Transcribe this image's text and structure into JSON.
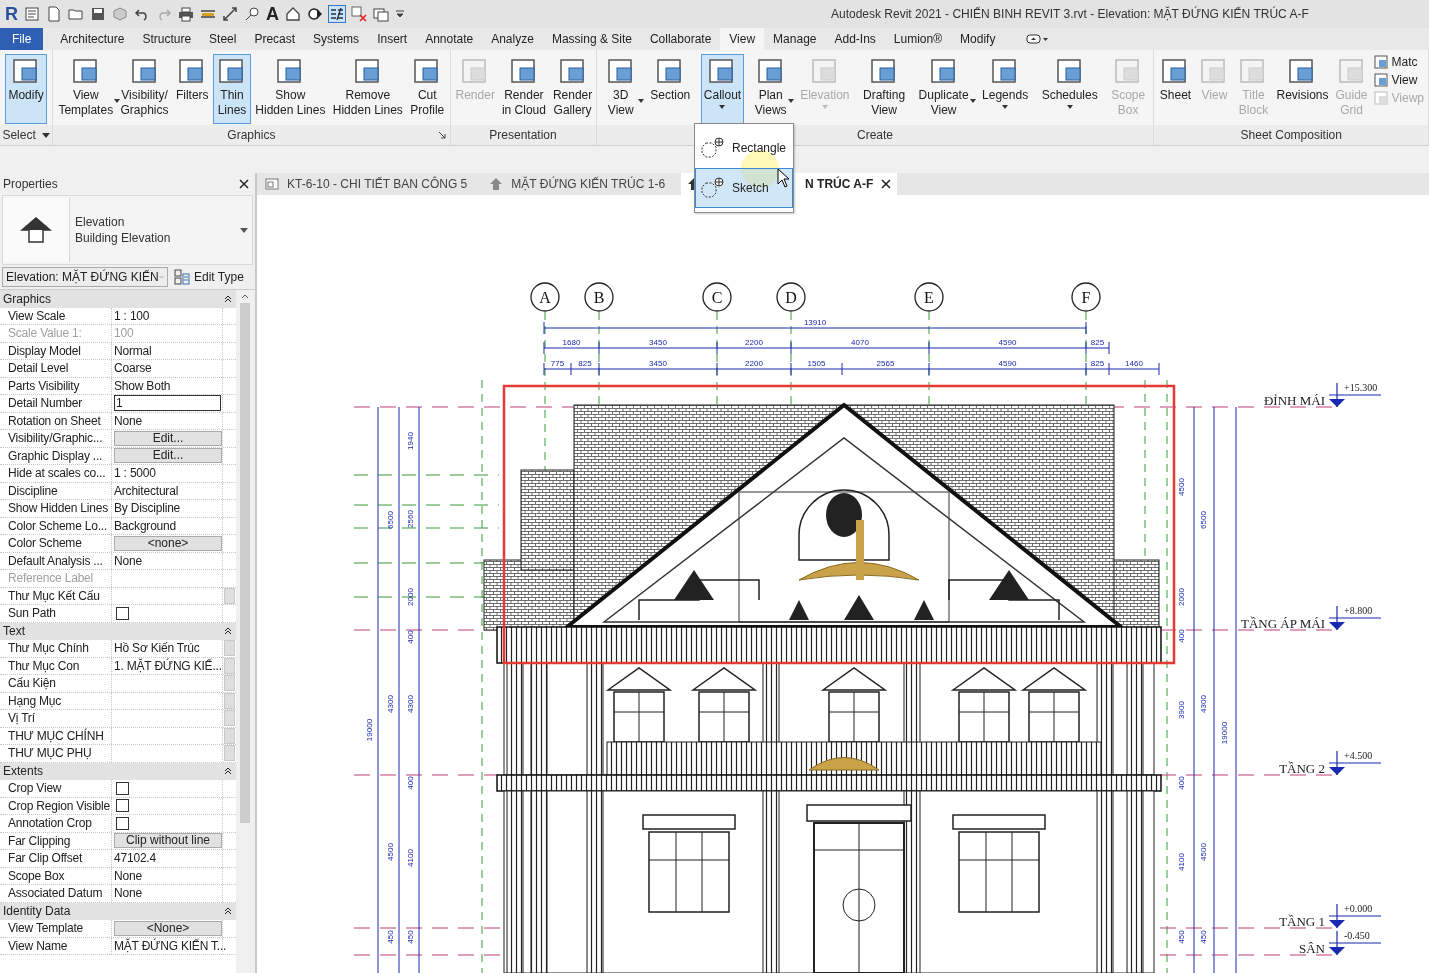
{
  "app": {
    "logo": "R",
    "text_tool": "A",
    "title": "Autodesk Revit 2021 - CHIẾN BINH REVIT 3.rvt - Elevation: MẶT ĐỨNG KIẾN TRÚC A-F"
  },
  "ribbon_tabs": [
    {
      "label": "File",
      "kind": "file",
      "selected": false
    },
    {
      "label": "Architecture",
      "kind": "tab",
      "selected": false
    },
    {
      "label": "Structure",
      "kind": "tab",
      "selected": false
    },
    {
      "label": "Steel",
      "kind": "tab",
      "selected": false
    },
    {
      "label": "Precast",
      "kind": "tab",
      "selected": false
    },
    {
      "label": "Systems",
      "kind": "tab",
      "selected": false
    },
    {
      "label": "Insert",
      "kind": "tab",
      "selected": false
    },
    {
      "label": "Annotate",
      "kind": "tab",
      "selected": false
    },
    {
      "label": "Analyze",
      "kind": "tab",
      "selected": false
    },
    {
      "label": "Massing & Site",
      "kind": "tab",
      "selected": false
    },
    {
      "label": "Collaborate",
      "kind": "tab",
      "selected": false
    },
    {
      "label": "View",
      "kind": "tab",
      "selected": true
    },
    {
      "label": "Manage",
      "kind": "tab",
      "selected": false
    },
    {
      "label": "Add-Ins",
      "kind": "tab",
      "selected": false
    },
    {
      "label": "Lumion®",
      "kind": "tab",
      "selected": false
    },
    {
      "label": "Modify",
      "kind": "tab",
      "selected": false
    }
  ],
  "ribbon_panels": [
    {
      "title": "Select",
      "title_menu": true,
      "launcher": false,
      "items": [
        {
          "kind": "large",
          "lines": [
            "Modify"
          ],
          "selected": true,
          "disabled": false,
          "side_menu": false,
          "below_menu": false
        }
      ]
    },
    {
      "title": "Graphics",
      "title_menu": false,
      "launcher": true,
      "items": [
        {
          "kind": "large",
          "lines": [
            "View",
            "Templates"
          ],
          "selected": false,
          "disabled": false,
          "side_menu": true,
          "below_menu": false
        },
        {
          "kind": "large",
          "lines": [
            "Visibility/",
            "Graphics"
          ],
          "selected": false,
          "disabled": false,
          "side_menu": false,
          "below_menu": false
        },
        {
          "kind": "large",
          "lines": [
            "Filters"
          ],
          "selected": false,
          "disabled": false,
          "side_menu": false,
          "below_menu": false
        },
        {
          "kind": "large",
          "lines": [
            "Thin",
            "Lines"
          ],
          "selected": true,
          "disabled": false,
          "side_menu": false,
          "below_menu": false
        },
        {
          "kind": "large",
          "lines": [
            "Show",
            "Hidden Lines"
          ],
          "selected": false,
          "disabled": false,
          "side_menu": false,
          "below_menu": false
        },
        {
          "kind": "large",
          "lines": [
            "Remove",
            "Hidden Lines"
          ],
          "selected": false,
          "disabled": false,
          "side_menu": false,
          "below_menu": false
        },
        {
          "kind": "large",
          "lines": [
            "Cut",
            "Profile"
          ],
          "selected": false,
          "disabled": false,
          "side_menu": false,
          "below_menu": false
        }
      ]
    },
    {
      "title": "Presentation",
      "title_menu": false,
      "launcher": false,
      "items": [
        {
          "kind": "large",
          "lines": [
            "Render"
          ],
          "selected": false,
          "disabled": true,
          "side_menu": false,
          "below_menu": false
        },
        {
          "kind": "large",
          "lines": [
            "Render",
            "in Cloud"
          ],
          "selected": false,
          "disabled": false,
          "side_menu": false,
          "below_menu": false
        },
        {
          "kind": "large",
          "lines": [
            "Render",
            "Gallery"
          ],
          "selected": false,
          "disabled": false,
          "side_menu": false,
          "below_menu": false
        }
      ]
    },
    {
      "title": "Create",
      "title_menu": false,
      "launcher": false,
      "items": [
        {
          "kind": "large",
          "lines": [
            "3D",
            "View"
          ],
          "selected": false,
          "disabled": false,
          "side_menu": true,
          "below_menu": false
        },
        {
          "kind": "large",
          "lines": [
            "Section"
          ],
          "selected": false,
          "disabled": false,
          "side_menu": false,
          "below_menu": false
        },
        {
          "kind": "large",
          "lines": [
            "Callout"
          ],
          "selected": true,
          "disabled": false,
          "side_menu": false,
          "below_menu": true
        },
        {
          "kind": "large",
          "lines": [
            "Plan",
            "Views"
          ],
          "selected": false,
          "disabled": false,
          "side_menu": true,
          "below_menu": false
        },
        {
          "kind": "large",
          "lines": [
            "Elevation"
          ],
          "selected": false,
          "disabled": true,
          "side_menu": false,
          "below_menu": true
        },
        {
          "kind": "large",
          "lines": [
            "Drafting",
            "View"
          ],
          "selected": false,
          "disabled": false,
          "side_menu": false,
          "below_menu": false
        },
        {
          "kind": "large",
          "lines": [
            "Duplicate",
            "View"
          ],
          "selected": false,
          "disabled": false,
          "side_menu": true,
          "below_menu": false
        },
        {
          "kind": "large",
          "lines": [
            "Legends"
          ],
          "selected": false,
          "disabled": false,
          "side_menu": false,
          "below_menu": true
        },
        {
          "kind": "large",
          "lines": [
            "Schedules"
          ],
          "selected": false,
          "disabled": false,
          "side_menu": false,
          "below_menu": true
        },
        {
          "kind": "large",
          "lines": [
            "Scope",
            "Box"
          ],
          "selected": false,
          "disabled": true,
          "side_menu": false,
          "below_menu": false
        }
      ]
    },
    {
      "title": "Sheet Composition",
      "title_menu": false,
      "launcher": false,
      "items": [
        {
          "kind": "large",
          "lines": [
            "Sheet"
          ],
          "selected": false,
          "disabled": false,
          "side_menu": false,
          "below_menu": false
        },
        {
          "kind": "large",
          "lines": [
            "View"
          ],
          "selected": false,
          "disabled": true,
          "side_menu": false,
          "below_menu": false
        },
        {
          "kind": "large",
          "lines": [
            "Title",
            "Block"
          ],
          "selected": false,
          "disabled": true,
          "side_menu": false,
          "below_menu": false
        },
        {
          "kind": "large",
          "lines": [
            "Revisions"
          ],
          "selected": false,
          "disabled": false,
          "side_menu": false,
          "below_menu": false
        },
        {
          "kind": "large",
          "lines": [
            "Guide",
            "Grid"
          ],
          "selected": false,
          "disabled": true,
          "side_menu": false,
          "below_menu": false
        },
        {
          "kind": "small",
          "entries": [
            {
              "label": "Matc",
              "disabled": false
            },
            {
              "label": "View",
              "disabled": false
            },
            {
              "label": "Viewp",
              "disabled": true
            }
          ]
        }
      ]
    }
  ],
  "callout_menu": [
    {
      "label": "Rectangle",
      "selected": false
    },
    {
      "label": "Sketch",
      "selected": true
    }
  ],
  "view_tabs": [
    {
      "label": "KT-6-10 - CHI TIẾT BAN CÔNG 5",
      "kind": "sheet",
      "selected": false,
      "closable": false
    },
    {
      "label": "MẶT ĐỨNG KIẾN TRÚC 1-6",
      "kind": "elevation",
      "selected": false,
      "closable": false
    },
    {
      "label": "N TRÚC A-F",
      "kind": "elevation",
      "selected": true,
      "closable": true
    }
  ],
  "properties": {
    "title": "Properties",
    "type_name": "Elevation",
    "type_detail": "Building Elevation",
    "instance": "Elevation: MẶT ĐỨNG KIẾN",
    "edit_type": "Edit Type",
    "sections": [
      {
        "name": "Graphics",
        "expanded": true,
        "rows": [
          {
            "label": "View Scale",
            "value": "1 : 100",
            "kind": "text",
            "disabled": false,
            "browse": false
          },
          {
            "label": "Scale Value    1:",
            "value": "100",
            "kind": "text",
            "disabled": true,
            "browse": false
          },
          {
            "label": "Display Model",
            "value": "Normal",
            "kind": "text",
            "disabled": false,
            "browse": false
          },
          {
            "label": "Detail Level",
            "value": "Coarse",
            "kind": "text",
            "disabled": false,
            "browse": false
          },
          {
            "label": "Parts Visibility",
            "value": "Show Both",
            "kind": "text",
            "disabled": false,
            "browse": false
          },
          {
            "label": "Detail Number",
            "value": "1",
            "kind": "input",
            "disabled": false,
            "browse": false
          },
          {
            "label": "Rotation on Sheet",
            "value": "None",
            "kind": "text",
            "disabled": false,
            "browse": false
          },
          {
            "label": "Visibility/Graphic...",
            "value": "Edit...",
            "kind": "button",
            "disabled": false,
            "browse": false
          },
          {
            "label": "Graphic Display ...",
            "value": "Edit...",
            "kind": "button",
            "disabled": false,
            "browse": false
          },
          {
            "label": "Hide at scales co...",
            "value": "1 : 5000",
            "kind": "text",
            "disabled": false,
            "browse": false
          },
          {
            "label": "Discipline",
            "value": "Architectural",
            "kind": "text",
            "disabled": false,
            "browse": false
          },
          {
            "label": "Show Hidden Lines",
            "value": "By Discipline",
            "kind": "text",
            "disabled": false,
            "browse": false
          },
          {
            "label": "Color Scheme Lo...",
            "value": "Background",
            "kind": "text",
            "disabled": false,
            "browse": false
          },
          {
            "label": "Color Scheme",
            "value": "<none>",
            "kind": "button",
            "disabled": false,
            "browse": false
          },
          {
            "label": "Default Analysis ...",
            "value": "None",
            "kind": "text",
            "disabled": false,
            "browse": false
          },
          {
            "label": "Reference Label",
            "kind": "text",
            "disabled": true,
            "browse": false
          },
          {
            "label": "Thư Mục Kết Cấu",
            "kind": "text",
            "disabled": false,
            "browse": true
          },
          {
            "label": "Sun Path",
            "kind": "checkbox",
            "checked": false,
            "disabled": false,
            "browse": false
          }
        ]
      },
      {
        "name": "Text",
        "expanded": true,
        "rows": [
          {
            "label": "Thư Mục Chính",
            "value": "Hồ Sơ Kiến Trúc",
            "kind": "text",
            "disabled": false,
            "browse": true
          },
          {
            "label": "Thư Mục Con",
            "value": "1. MẶT ĐỨNG KIẾ...",
            "kind": "text",
            "disabled": false,
            "browse": true
          },
          {
            "label": "Cấu Kiện",
            "kind": "text",
            "disabled": false,
            "browse": true
          },
          {
            "label": "Hạng Mục",
            "kind": "text",
            "disabled": false,
            "browse": true
          },
          {
            "label": "Vị Trí",
            "kind": "text",
            "disabled": false,
            "browse": true
          },
          {
            "label": "THƯ MỤC CHÍNH",
            "kind": "text",
            "disabled": false,
            "browse": true
          },
          {
            "label": "THƯ MỤC PHỤ",
            "kind": "text",
            "disabled": false,
            "browse": true
          }
        ]
      },
      {
        "name": "Extents",
        "expanded": true,
        "rows": [
          {
            "label": "Crop View",
            "kind": "checkbox",
            "checked": false,
            "disabled": false,
            "browse": false
          },
          {
            "label": "Crop Region Visible",
            "kind": "checkbox",
            "checked": false,
            "disabled": false,
            "browse": false
          },
          {
            "label": "Annotation Crop",
            "kind": "checkbox",
            "checked": false,
            "disabled": false,
            "browse": false
          },
          {
            "label": "Far Clipping",
            "value": "Clip without line",
            "kind": "button",
            "disabled": false,
            "browse": false
          },
          {
            "label": "Far Clip Offset",
            "value": "47102.4",
            "kind": "text",
            "disabled": false,
            "browse": false
          },
          {
            "label": "Scope Box",
            "value": "None",
            "kind": "text",
            "disabled": false,
            "browse": false
          },
          {
            "label": "Associated Datum",
            "value": "None",
            "kind": "text",
            "disabled": false,
            "browse": false
          }
        ]
      },
      {
        "name": "Identity Data",
        "expanded": true,
        "rows": [
          {
            "label": "View Template",
            "value": "<None>",
            "kind": "button",
            "disabled": false,
            "browse": false
          },
          {
            "label": "View Name",
            "value": "MẶT ĐỨNG KIẾN T...",
            "kind": "text",
            "disabled": false,
            "browse": false
          }
        ]
      }
    ]
  },
  "drawing": {
    "grids": [
      "A",
      "B",
      "C",
      "D",
      "E",
      "F"
    ],
    "levels": [
      {
        "name": "ĐỈNH MÁI",
        "elevation": "+15.300"
      },
      {
        "name": "TẦNG ÁP MÁI",
        "elevation": "+8.800"
      },
      {
        "name": "TẦNG 2",
        "elevation": "+4.500"
      },
      {
        "name": "TẦNG 1",
        "elevation": "+0.000"
      },
      {
        "name": "SÂN",
        "elevation": "-0.450"
      }
    ],
    "dims_top": [
      {
        "values": [
          "13910"
        ]
      },
      {
        "values": [
          "1680",
          "3450",
          "2200",
          "4070",
          "4590",
          "825"
        ]
      },
      {
        "values": [
          "775",
          "825",
          "3450",
          "2200",
          "1505",
          "2565",
          "4590",
          "825",
          "1460"
        ]
      }
    ],
    "dims_left": [
      {
        "values": [
          "1940",
          "2560",
          "2000",
          "400",
          "4300",
          "400",
          "4100",
          "450"
        ]
      },
      {
        "values": [
          "6500",
          "4300",
          "4500",
          "450"
        ]
      },
      {
        "values": [
          "19000"
        ]
      }
    ],
    "dims_right": [
      {
        "values": [
          "4500",
          "2000",
          "400",
          "3900",
          "400",
          "4100",
          "450"
        ]
      },
      {
        "values": [
          "6500",
          "4300",
          "4500",
          "450"
        ]
      },
      {
        "values": [
          "19000"
        ]
      }
    ]
  }
}
